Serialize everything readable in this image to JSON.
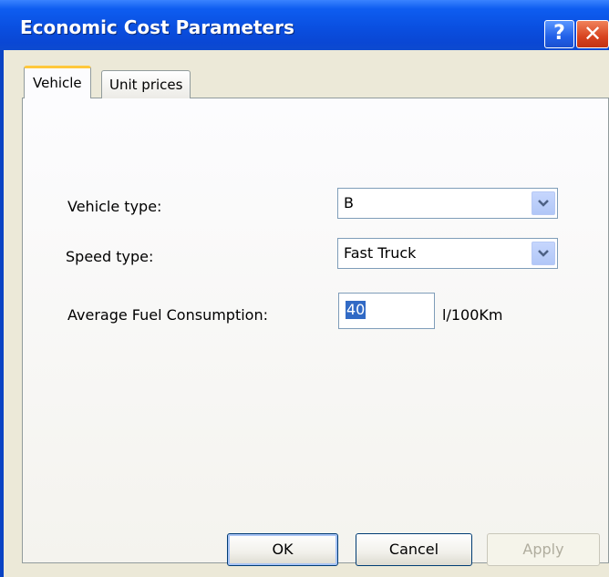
{
  "window": {
    "title": "Economic Cost Parameters",
    "help_glyph": "?",
    "close_glyph": "✕"
  },
  "tabs": [
    {
      "label": "Vehicle",
      "selected": true
    },
    {
      "label": "Unit prices",
      "selected": false
    }
  ],
  "form": {
    "vehicle_type_label": "Vehicle type:",
    "vehicle_type_value": "B",
    "speed_type_label": "Speed type:",
    "speed_type_value": "Fast Truck",
    "fuel_label": "Average Fuel Consumption:",
    "fuel_value": "40",
    "fuel_unit": "l/100Km"
  },
  "buttons": {
    "ok": "OK",
    "cancel": "Cancel",
    "apply": "Apply"
  },
  "colors": {
    "title_bar": "#0a4fe0",
    "dialog_face": "#ece9d8",
    "selection": "#316ac5",
    "active_tab_accent": "#ffc83c"
  }
}
